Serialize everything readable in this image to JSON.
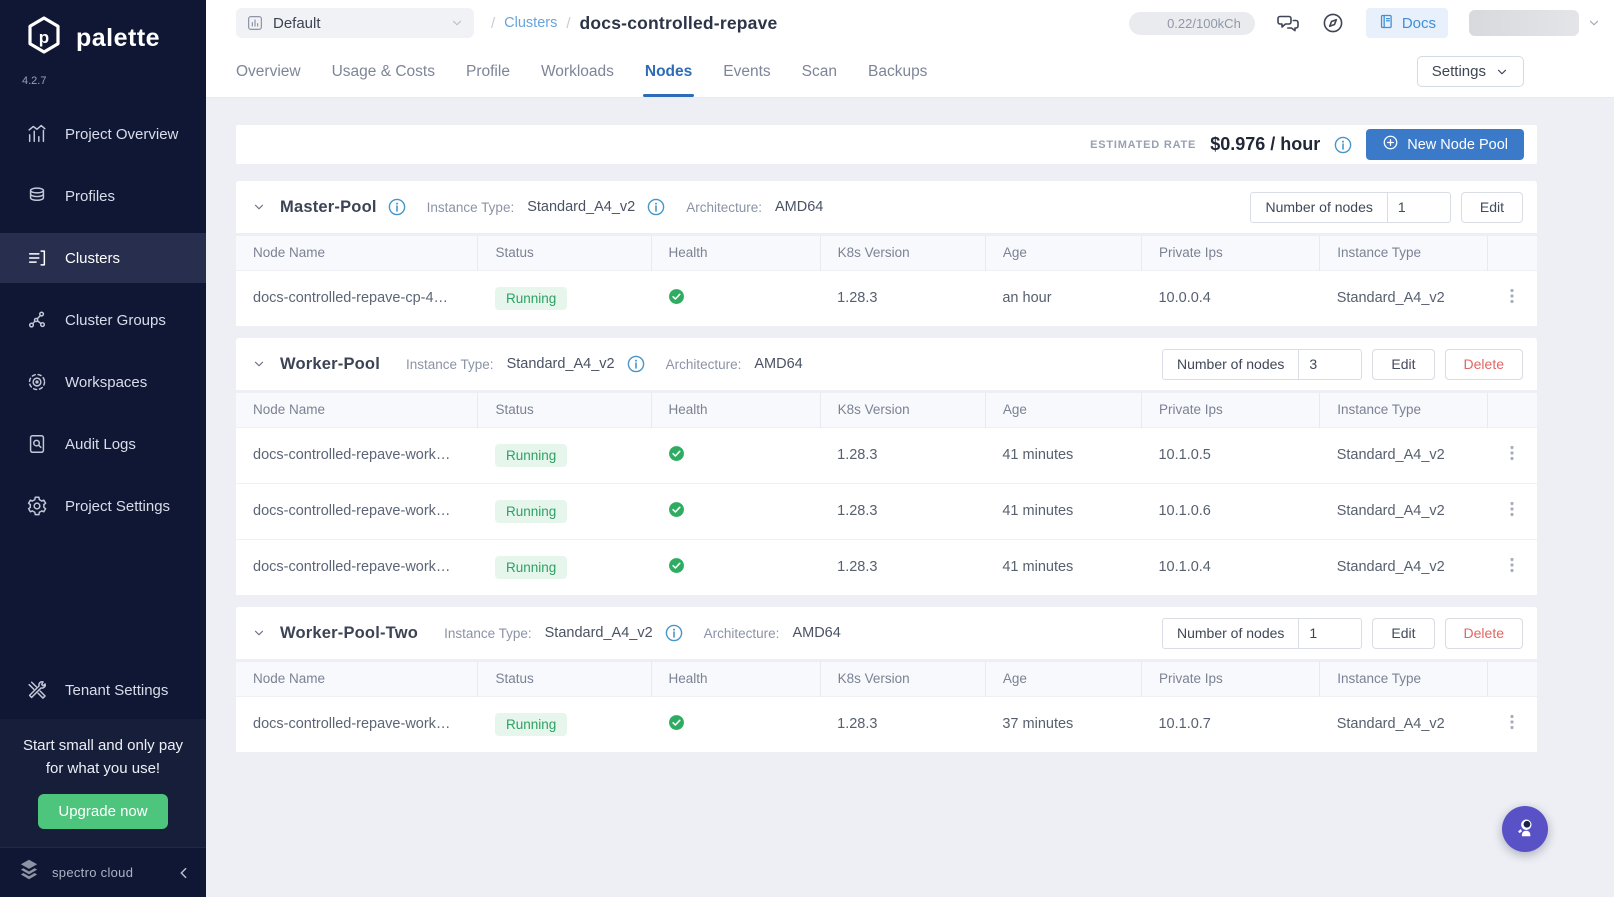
{
  "sidebar": {
    "logo_text": "palette",
    "version": "4.2.7",
    "items": [
      {
        "label": "Project Overview",
        "icon": "bar-chart-icon",
        "active": false
      },
      {
        "label": "Profiles",
        "icon": "layers-icon",
        "active": false
      },
      {
        "label": "Clusters",
        "icon": "clusters-icon",
        "active": true
      },
      {
        "label": "Cluster Groups",
        "icon": "network-icon",
        "active": false
      },
      {
        "label": "Workspaces",
        "icon": "workspaces-icon",
        "active": false
      },
      {
        "label": "Audit Logs",
        "icon": "audit-icon",
        "active": false
      },
      {
        "label": "Project Settings",
        "icon": "gear-icon",
        "active": false
      }
    ],
    "tenant_settings": {
      "label": "Tenant Settings",
      "icon": "tools-icon"
    },
    "promo": {
      "text": "Start small and only pay for what you use!",
      "button": "Upgrade now"
    },
    "footer_brand": "spectro cloud"
  },
  "header": {
    "project_selector": "Default",
    "breadcrumb": {
      "separator": "/",
      "section": "Clusters",
      "current": "docs-controlled-repave"
    },
    "usage_badge": "0.22/100kCh",
    "docs_button": "Docs"
  },
  "tabs": {
    "items": [
      "Overview",
      "Usage & Costs",
      "Profile",
      "Workloads",
      "Nodes",
      "Events",
      "Scan",
      "Backups"
    ],
    "active": "Nodes",
    "settings_button": "Settings"
  },
  "rate_bar": {
    "label": "ESTIMATED RATE",
    "value": "$0.976 / hour",
    "new_pool_button": "New Node Pool"
  },
  "table": {
    "columns": [
      "Node Name",
      "Status",
      "Health",
      "K8s Version",
      "Age",
      "Private Ips",
      "Instance Type"
    ]
  },
  "pool_labels": {
    "instance_type": "Instance Type:",
    "architecture": "Architecture:",
    "nodes": "Number of nodes",
    "edit": "Edit",
    "delete": "Delete"
  },
  "pools": [
    {
      "name": "Master-Pool",
      "name_info": true,
      "instance_type": "Standard_A4_v2",
      "architecture": "AMD64",
      "nodes_count": "1",
      "actions": [
        "edit"
      ],
      "rows": [
        {
          "name": "docs-controlled-repave-cp-4…",
          "status": "Running",
          "k8s": "1.28.3",
          "age": "an hour",
          "ip": "10.0.0.4",
          "instance": "Standard_A4_v2"
        }
      ]
    },
    {
      "name": "Worker-Pool",
      "name_info": false,
      "instance_type": "Standard_A4_v2",
      "architecture": "AMD64",
      "nodes_count": "3",
      "actions": [
        "edit",
        "delete"
      ],
      "rows": [
        {
          "name": "docs-controlled-repave-work…",
          "status": "Running",
          "k8s": "1.28.3",
          "age": "41 minutes",
          "ip": "10.1.0.5",
          "instance": "Standard_A4_v2"
        },
        {
          "name": "docs-controlled-repave-work…",
          "status": "Running",
          "k8s": "1.28.3",
          "age": "41 minutes",
          "ip": "10.1.0.6",
          "instance": "Standard_A4_v2"
        },
        {
          "name": "docs-controlled-repave-work…",
          "status": "Running",
          "k8s": "1.28.3",
          "age": "41 minutes",
          "ip": "10.1.0.4",
          "instance": "Standard_A4_v2"
        }
      ]
    },
    {
      "name": "Worker-Pool-Two",
      "name_info": false,
      "instance_type": "Standard_A4_v2",
      "architecture": "AMD64",
      "nodes_count": "1",
      "actions": [
        "edit",
        "delete"
      ],
      "rows": [
        {
          "name": "docs-controlled-repave-work…",
          "status": "Running",
          "k8s": "1.28.3",
          "age": "37 minutes",
          "ip": "10.1.0.7",
          "instance": "Standard_A4_v2"
        }
      ]
    }
  ],
  "icons": {
    "status_ok": "check-circle-icon",
    "row_menu": "kebab-menu-icon",
    "info": "info-icon",
    "new_pool": "plus-circle-icon",
    "fab": "astronaut-icon"
  },
  "colors": {
    "sidebar_bg": "#101734",
    "accent_blue": "#3b79c9",
    "active_tab_blue": "#2d6cb7",
    "link_blue": "#68a4da",
    "running_green": "#2da163",
    "danger_red": "#e06663",
    "upgrade_green": "#4ec57d",
    "fab_purple": "#5952c6"
  }
}
